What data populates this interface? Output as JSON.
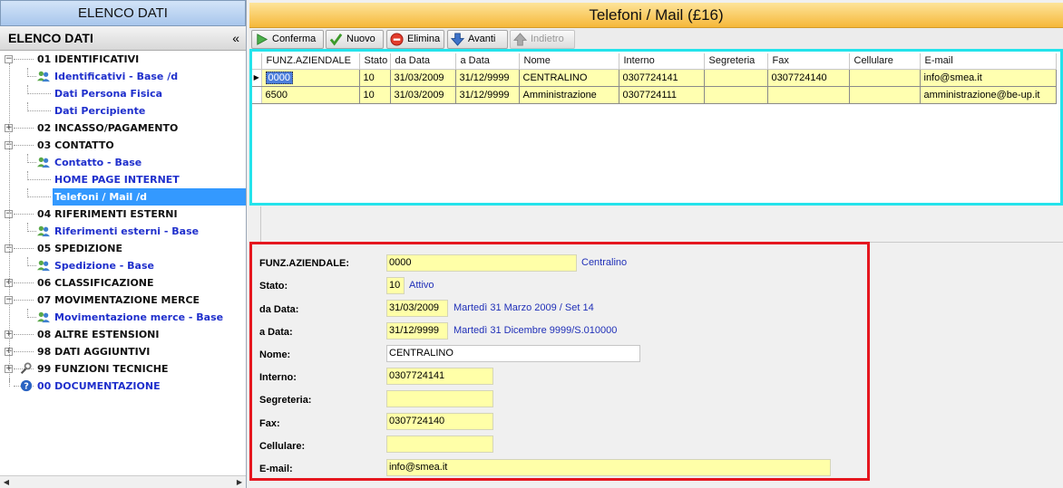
{
  "left_panel": {
    "top_title": "ELENCO DATI",
    "header_title": "ELENCO DATI",
    "collapse_glyph": "«"
  },
  "tree": [
    {
      "label": "01 IDENTIFICATIVI",
      "kind": "top",
      "toggle": "−",
      "icon": ""
    },
    {
      "label": "Identificativi - Base /d",
      "kind": "leaf",
      "icon": "users-icon"
    },
    {
      "label": "Dati Persona Fisica",
      "kind": "leaf",
      "icon": ""
    },
    {
      "label": "Dati Percipiente",
      "kind": "leaf",
      "icon": ""
    },
    {
      "label": "02 INCASSO/PAGAMENTO",
      "kind": "top",
      "toggle": "+",
      "icon": ""
    },
    {
      "label": "03 CONTATTO",
      "kind": "top",
      "toggle": "−",
      "icon": ""
    },
    {
      "label": "Contatto - Base",
      "kind": "leaf",
      "icon": "users-icon"
    },
    {
      "label": "HOME PAGE INTERNET",
      "kind": "leaf",
      "icon": ""
    },
    {
      "label": "Telefoni / Mail /d",
      "kind": "leaf",
      "icon": "",
      "selected": true
    },
    {
      "label": "04 RIFERIMENTI ESTERNI",
      "kind": "top",
      "toggle": "−",
      "icon": ""
    },
    {
      "label": "Riferimenti esterni - Base",
      "kind": "leaf",
      "icon": "users-icon"
    },
    {
      "label": "05 SPEDIZIONE",
      "kind": "top",
      "toggle": "−",
      "icon": ""
    },
    {
      "label": "Spedizione - Base",
      "kind": "leaf",
      "icon": "users-icon"
    },
    {
      "label": "06 CLASSIFICAZIONE",
      "kind": "top",
      "toggle": "+",
      "icon": ""
    },
    {
      "label": "07 MOVIMENTAZIONE MERCE",
      "kind": "top",
      "toggle": "−",
      "icon": ""
    },
    {
      "label": "Movimentazione merce - Base",
      "kind": "leaf",
      "icon": "users-icon"
    },
    {
      "label": "08 ALTRE ESTENSIONI",
      "kind": "top",
      "toggle": "+",
      "icon": ""
    },
    {
      "label": "98 DATI AGGIUNTIVI",
      "kind": "top",
      "toggle": "+",
      "icon": ""
    },
    {
      "label": "99 FUNZIONI TECNICHE",
      "kind": "top",
      "toggle": "+",
      "icon": "wrench-icon"
    },
    {
      "label": "00 DOCUMENTAZIONE",
      "kind": "topblue",
      "toggle": "",
      "icon": "help-icon"
    }
  ],
  "window_title": "Telefoni / Mail (£16)",
  "toolbar": {
    "confirm": "Conferma",
    "new": "Nuovo",
    "delete": "Elimina",
    "forward": "Avanti",
    "back": "Indietro"
  },
  "grid": {
    "columns": [
      "FUNZ.AZIENDALE",
      "Stato",
      "da Data",
      "a  Data",
      "Nome",
      "Interno",
      "Segreteria",
      "Fax",
      "Cellulare",
      "E-mail"
    ],
    "rows": [
      [
        "0000",
        "10",
        "31/03/2009",
        "31/12/9999",
        "CENTRALINO",
        "0307724141",
        "",
        "0307724140",
        "",
        "info@smea.it"
      ],
      [
        "6500",
        "10",
        "31/03/2009",
        "31/12/9999",
        "Amministrazione",
        "0307724111",
        "",
        "",
        "",
        "amministrazione@be-up.it"
      ]
    ]
  },
  "detail": {
    "labels": {
      "funz": "FUNZ.AZIENDALE:",
      "stato": "Stato:",
      "da_data": "da Data:",
      "a_data": "a  Data:",
      "nome": "Nome:",
      "interno": "Interno:",
      "segreteria": "Segreteria:",
      "fax": "Fax:",
      "cellulare": "Cellulare:",
      "email": "E-mail:"
    },
    "values": {
      "funz": "0000",
      "stato": "10",
      "da_data": "31/03/2009",
      "a_data": "31/12/9999",
      "nome": "CENTRALINO",
      "interno": "0307724141",
      "segreteria": "",
      "fax": "0307724140",
      "cellulare": "",
      "email": "info@smea.it"
    },
    "descriptions": {
      "funz": "Centralino",
      "stato": "Attivo",
      "da_data": "Martedì 31 Marzo 2009 / Set 14",
      "a_data": "Martedì 31 Dicembre 9999/S.010000"
    }
  },
  "colors": {
    "grid_highlight": "#24e3eb",
    "detail_highlight": "#e5171f",
    "title_bar": "#f6b83a",
    "selected_item": "#3399ff",
    "field_yellow": "#ffffa8"
  }
}
